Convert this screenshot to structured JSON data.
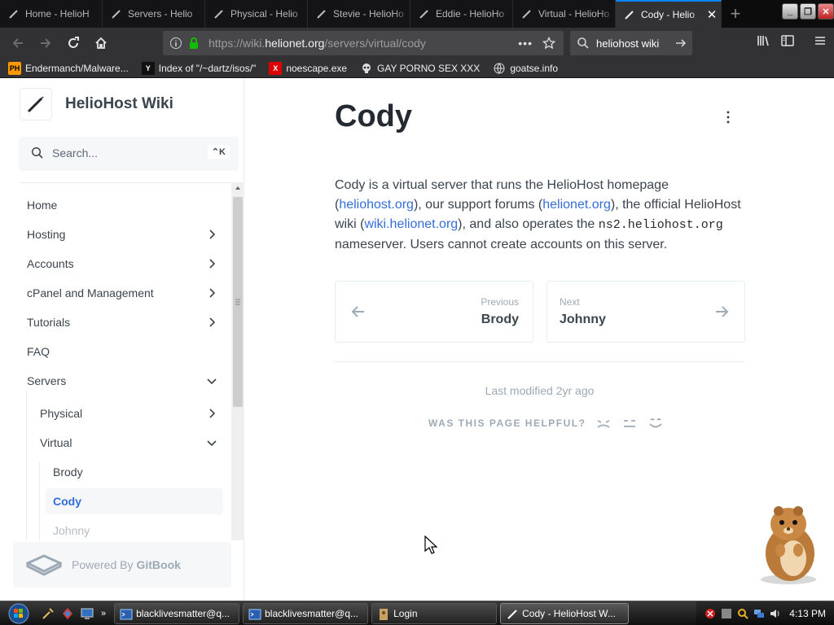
{
  "browser": {
    "tabs": [
      {
        "label": "Home - HelioH",
        "active": false
      },
      {
        "label": "Servers - Helio",
        "active": false
      },
      {
        "label": "Physical - Helio",
        "active": false
      },
      {
        "label": "Stevie - HelioHo",
        "active": false
      },
      {
        "label": "Eddie - HelioHo",
        "active": false
      },
      {
        "label": "Virtual - HelioHo",
        "active": false
      },
      {
        "label": "Cody - Helio",
        "active": true
      }
    ],
    "close_glyph": "✕",
    "new_tab_glyph": "+",
    "url_prefix": "https://wiki.",
    "url_domain": "helionet.org",
    "url_path": "/servers/virtual/cody",
    "url_more": "•••",
    "search_value": "heliohost wiki",
    "bookmarks": [
      {
        "label": "Endermanch/Malware...",
        "icon": "PH"
      },
      {
        "label": "Index of \"/~dartz/isos/\"",
        "icon": "Y"
      },
      {
        "label": "noescape.exe",
        "icon": "X"
      },
      {
        "label": "GAY PORNO SEX XXX",
        "icon": "skull"
      },
      {
        "label": "goatse.info",
        "icon": "globe"
      }
    ]
  },
  "sidebar": {
    "site_title": "HelioHost Wiki",
    "search_placeholder": "Search...",
    "search_shortcut": "⌃K",
    "items": [
      {
        "label": "Home",
        "chevron": "none"
      },
      {
        "label": "Hosting",
        "chevron": "right"
      },
      {
        "label": "Accounts",
        "chevron": "right"
      },
      {
        "label": "cPanel and Management",
        "chevron": "right"
      },
      {
        "label": "Tutorials",
        "chevron": "right"
      },
      {
        "label": "FAQ",
        "chevron": "none"
      },
      {
        "label": "Servers",
        "chevron": "down"
      },
      {
        "label": "Physical",
        "chevron": "right"
      },
      {
        "label": "Virtual",
        "chevron": "down"
      },
      {
        "label": "Brody",
        "chevron": "none"
      },
      {
        "label": "Cody",
        "chevron": "none"
      },
      {
        "label": "Johnny",
        "chevron": "none"
      }
    ],
    "powered_by": "Powered By",
    "powered_by_brand": "GitBook"
  },
  "content": {
    "title": "Cody",
    "para_1": "Cody is a virtual server that runs the HelioHost homepage (",
    "link_1": "heliohost.org",
    "para_2": "), our support forums (",
    "link_2": "helionet.org",
    "para_3": "), the official HelioHost wiki (",
    "link_3": "wiki.helionet.org",
    "para_4": "), and also operates the ",
    "code": "ns2.heliohost.org",
    "para_5": " nameserver. Users cannot create accounts on this server.",
    "prev_label": "Previous",
    "prev_title": "Brody",
    "next_label": "Next",
    "next_title": "Johnny",
    "last_modified": "Last modified 2yr ago",
    "helpful": "WAS THIS PAGE HELPFUL?"
  },
  "taskbar": {
    "tasks": [
      {
        "label": "blacklivesmatter@q...",
        "active": false
      },
      {
        "label": "blacklivesmatter@q...",
        "active": false
      },
      {
        "label": "Login",
        "active": false
      },
      {
        "label": "Cody - HelioHost W...",
        "active": true
      }
    ],
    "clock": "4:13 PM"
  },
  "colors": {
    "accent": "#346ddb",
    "tab_highlight": "#0a84ff"
  }
}
